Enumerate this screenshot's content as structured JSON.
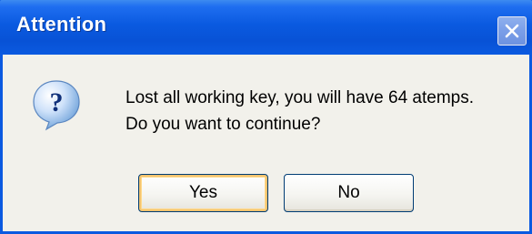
{
  "window": {
    "title": "Attention",
    "close_icon": "close-icon"
  },
  "dialog": {
    "icon": "question-icon",
    "message_line1": "Lost all working key, you will have 64 atemps.",
    "message_line2": "Do you want to continue?"
  },
  "buttons": {
    "yes_label": "Yes",
    "no_label": "No"
  },
  "colors": {
    "titlebar": "#0a5ae0",
    "dialog_bg": "#f2f1eb",
    "button_border": "#003c74",
    "default_button_focus": "#f2c470"
  }
}
